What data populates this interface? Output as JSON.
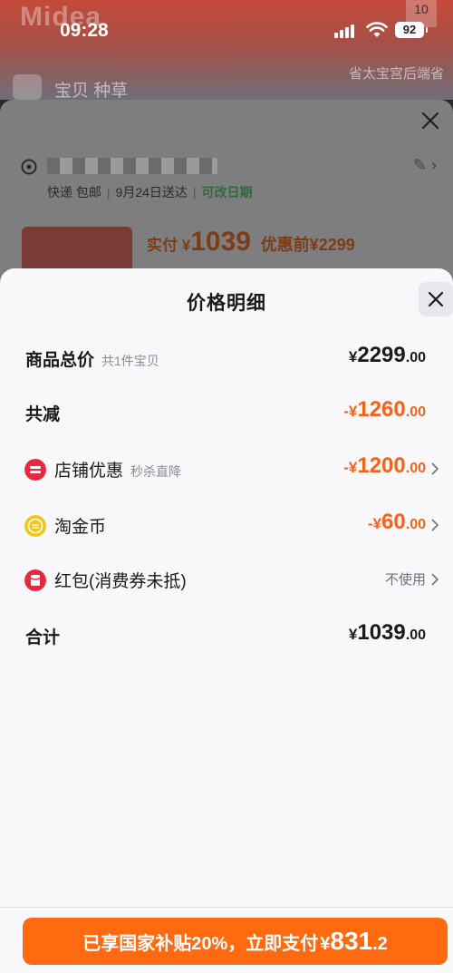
{
  "status_bar": {
    "time": "09:28",
    "battery": "92"
  },
  "background": {
    "brand_logo": "Midea",
    "badge": "10",
    "nav_title": "宝贝  种草",
    "shop_name": "省太宝宫后端省",
    "shipping": {
      "method": "快递 包邮",
      "delivery": "9月24日送达",
      "change_date": "可改日期"
    },
    "paid_label": "实付",
    "paid_currency": "¥",
    "paid_amount": "1039",
    "before_discount": "优惠前¥2299"
  },
  "price_detail": {
    "title": "价格明细",
    "total": {
      "label": "商品总价",
      "sub": "共1件宝贝",
      "currency": "¥",
      "int": "2299",
      "dec": ".00"
    },
    "reduction": {
      "label": "共减",
      "currency": "-¥",
      "int": "1260",
      "dec": ".00"
    },
    "shop_discount": {
      "label": "店铺优惠",
      "sub": "秒杀直降",
      "currency": "-¥",
      "int": "1200",
      "dec": ".00"
    },
    "taojinbi": {
      "label": "淘金币",
      "currency": "-¥",
      "int": "60",
      "dec": ".00"
    },
    "red_packet": {
      "label": "红包(消费券未抵)",
      "value": "不使用"
    },
    "sum": {
      "label": "合计",
      "currency": "¥",
      "int": "1039",
      "dec": ".00"
    }
  },
  "pay_button": {
    "text": "已享国家补贴20%，立即支付",
    "currency": "¥",
    "int": "831",
    "dec": ".2"
  },
  "colors": {
    "accent": "#ff6a10",
    "discount": "#f2631b",
    "shop_icon": "#e8283c",
    "coin_icon": "#f5c518"
  }
}
